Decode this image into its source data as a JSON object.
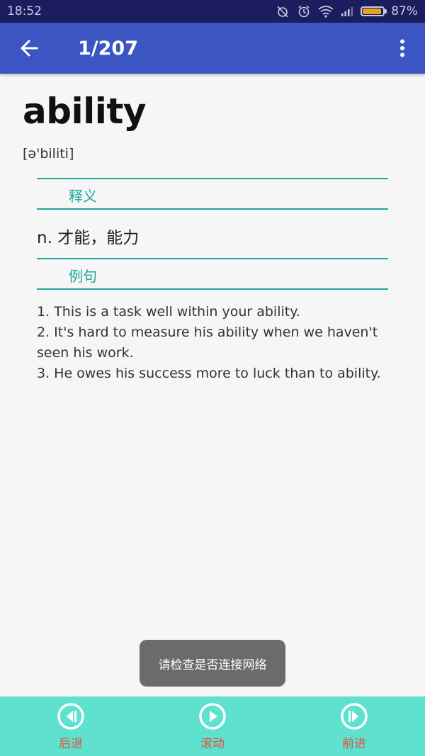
{
  "status_bar": {
    "time": "18:52",
    "battery_percent": "87%",
    "battery_level": 0.87,
    "icons": [
      "alarm-off-icon",
      "alarm-icon",
      "wifi-icon",
      "signal-icon",
      "battery-icon"
    ]
  },
  "app_bar": {
    "title": "1/207",
    "back_icon": "arrow-left-icon",
    "menu_icon": "more-vert-icon",
    "color": "#3b56c2"
  },
  "word": {
    "headword": "ability",
    "phonetic": "[ə'biliti]"
  },
  "sections": {
    "definition_label": "释义",
    "definition": "n. 才能，能力",
    "examples_label": "例句",
    "examples": [
      "1. This is a task well within your ability.",
      "2. It's hard to measure his ability when we haven't seen his work.",
      "3. He owes his success more to luck than to ability."
    ],
    "accent_color": "#1aa89a"
  },
  "toast": {
    "message": "请检查是否连接网络"
  },
  "bottom_bar": {
    "background": "#5ee1cf",
    "label_color": "#e0533f",
    "items": [
      {
        "label": "后退",
        "icon": "previous-icon"
      },
      {
        "label": "滚动",
        "icon": "play-icon"
      },
      {
        "label": "前进",
        "icon": "next-icon"
      }
    ]
  }
}
